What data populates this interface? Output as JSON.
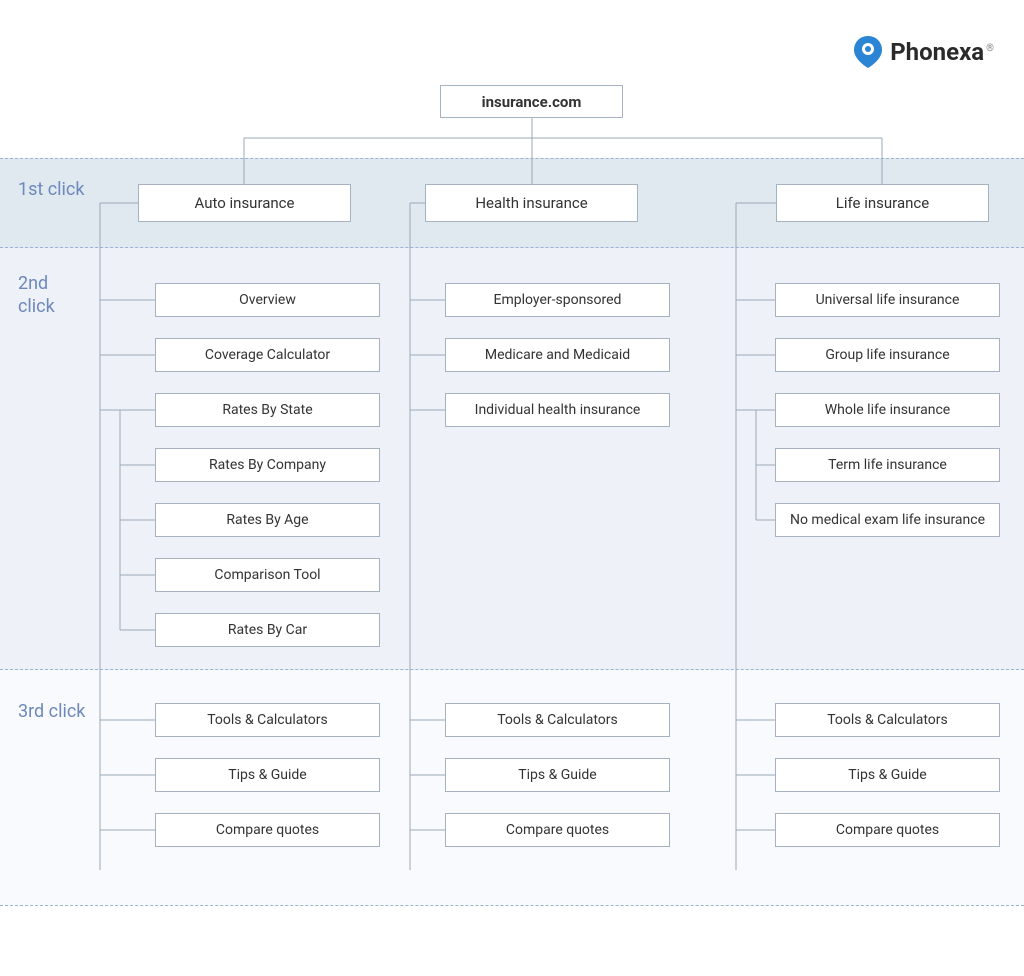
{
  "brand": {
    "name": "Phonexa"
  },
  "root": {
    "title": "insurance.com"
  },
  "labels": {
    "first": "1st click",
    "second": "2nd click",
    "third": "3rd click"
  },
  "columns": [
    {
      "category": "Auto insurance",
      "second": [
        "Overview",
        "Coverage Calculator",
        "Rates By State",
        "Rates By Company",
        "Rates By Age",
        "Comparison Tool",
        "Rates By Car"
      ],
      "third": [
        "Tools & Calculators",
        "Tips & Guide",
        "Compare quotes"
      ]
    },
    {
      "category": "Health insurance",
      "second": [
        "Employer-sponsored",
        "Medicare and Medicaid",
        "Individual health insurance"
      ],
      "third": [
        "Tools & Calculators",
        "Tips & Guide",
        "Compare quotes"
      ]
    },
    {
      "category": "Life insurance",
      "second": [
        "Universal life insurance",
        "Group life insurance",
        "Whole life insurance",
        "Term life insurance",
        "No medical exam life insurance"
      ],
      "third": [
        "Tools & Calculators",
        "Tips & Guide",
        "Compare quotes"
      ]
    }
  ]
}
